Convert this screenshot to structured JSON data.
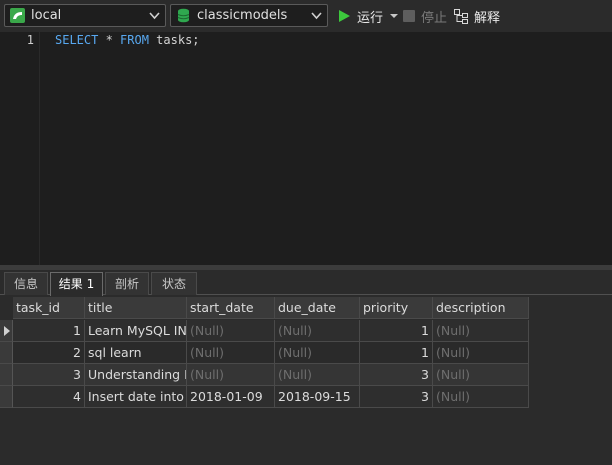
{
  "toolbar": {
    "connection": "local",
    "database": "classicmodels",
    "run_label": "运行",
    "stop_label": "停止",
    "explain_label": "解释"
  },
  "editor": {
    "line_number": "1",
    "sql": {
      "kw1": "SELECT",
      "star": " * ",
      "kw2": "FROM",
      "rest": " tasks;"
    }
  },
  "tabs": [
    {
      "label": "信息",
      "active": false
    },
    {
      "label": "结果 1",
      "active": true
    },
    {
      "label": "剖析",
      "active": false
    },
    {
      "label": "状态",
      "active": false
    }
  ],
  "result": {
    "columns": [
      "task_id",
      "title",
      "start_date",
      "due_date",
      "priority",
      "description"
    ],
    "rows": [
      [
        "1",
        "Learn MySQL INSERT",
        "(Null)",
        "(Null)",
        "1",
        "(Null)"
      ],
      [
        "2",
        "sql learn",
        "(Null)",
        "(Null)",
        "1",
        "(Null)"
      ],
      [
        "3",
        "Understanding DATE",
        "(Null)",
        "(Null)",
        "3",
        "(Null)"
      ],
      [
        "4",
        "Insert date into table",
        "2018-01-09",
        "2018-09-15",
        "3",
        "(Null)"
      ]
    ]
  },
  "colors": {
    "run_green": "#3cc83c",
    "keyword_blue": "#58a8f0",
    "db_green": "#2fa84f"
  }
}
